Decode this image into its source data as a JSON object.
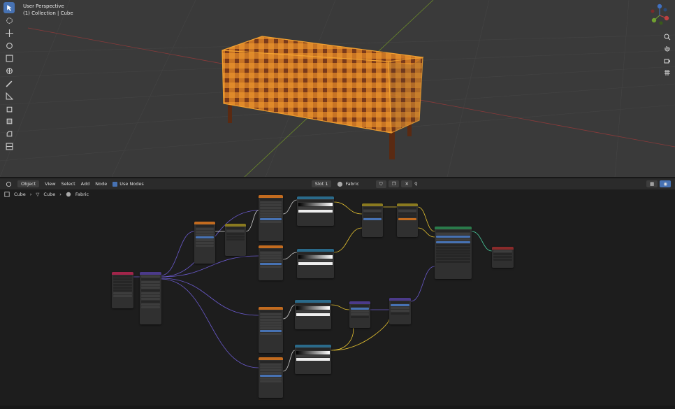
{
  "viewport": {
    "perspective_label": "User Perspective",
    "collection_label": "(1) Collection | Cube",
    "tools": [
      "select-box",
      "cursor",
      "move",
      "rotate",
      "scale",
      "transform",
      "annotate",
      "measure",
      "add-cube",
      "extrude",
      "inset",
      "bevel",
      "loop-cut"
    ],
    "gizmo_axes": [
      "X",
      "Y",
      "Z"
    ],
    "colors": {
      "bg": "#3a3a3a",
      "grid": "#444444",
      "x_axis": "#8a3a3a",
      "y_axis": "#6b8a2a",
      "cloth_a": "#e08a2a",
      "cloth_b": "#7a3a1a",
      "outline": "#f0a030"
    }
  },
  "node_header": {
    "editor_type": "Object",
    "menus": [
      "View",
      "Select",
      "Add",
      "Node"
    ],
    "use_nodes_label": "Use Nodes",
    "slot_label": "Slot 1",
    "material_name": "Fabric"
  },
  "breadcrumb": {
    "items": [
      "Cube",
      "Cube",
      "Fabric"
    ]
  },
  "nodes": [
    {
      "id": "texcoord",
      "color": "#a1254a"
    },
    {
      "id": "mapping",
      "color": "#4b3a8a"
    },
    {
      "id": "wave1",
      "color": "#c26b1f"
    },
    {
      "id": "mix1",
      "color": "#8a7a1f"
    },
    {
      "id": "wave2",
      "color": "#c26b1f"
    },
    {
      "id": "wave3",
      "color": "#c26b1f"
    },
    {
      "id": "ramp1",
      "color": "#2a6a8a"
    },
    {
      "id": "ramp2",
      "color": "#2a6a8a"
    },
    {
      "id": "mixrgb",
      "color": "#8a7a1f"
    },
    {
      "id": "mix2",
      "color": "#8a7a1f"
    },
    {
      "id": "bsdf",
      "color": "#2a7a4a"
    },
    {
      "id": "output",
      "color": "#8a2a2a"
    },
    {
      "id": "wave4",
      "color": "#c26b1f"
    },
    {
      "id": "ramp3",
      "color": "#2a6a8a"
    },
    {
      "id": "bump1",
      "color": "#4b3a8a"
    },
    {
      "id": "bump2",
      "color": "#4b3a8a"
    },
    {
      "id": "wave5",
      "color": "#c26b1f"
    },
    {
      "id": "ramp4",
      "color": "#2a6a8a"
    }
  ]
}
